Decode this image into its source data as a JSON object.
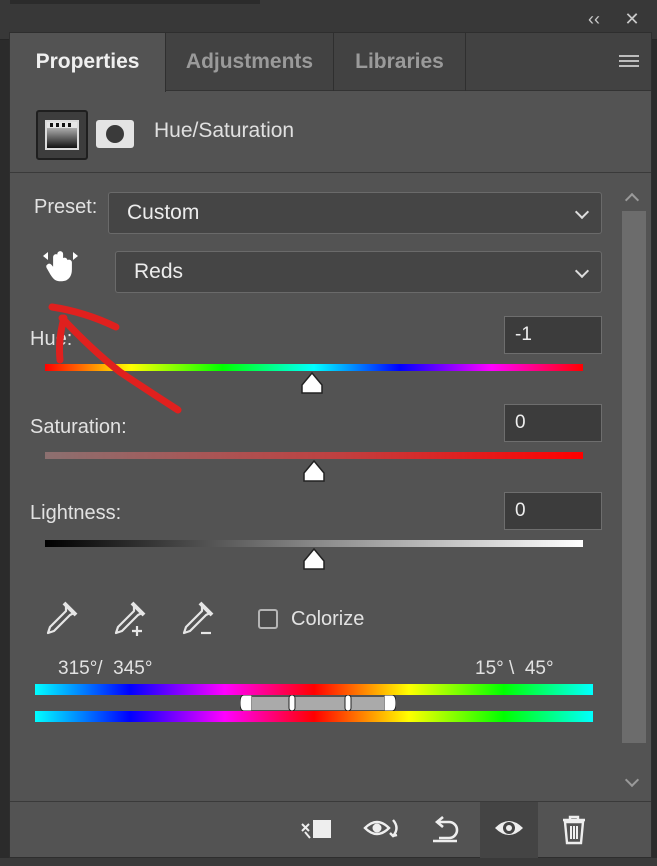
{
  "window": {
    "collapse_glyph": "‹‹",
    "close_glyph": "✕"
  },
  "tabs": [
    {
      "label": "Properties",
      "active": true
    },
    {
      "label": "Adjustments",
      "active": false
    },
    {
      "label": "Libraries",
      "active": false
    }
  ],
  "header": {
    "adjustment_title": "Hue/Saturation",
    "icons": [
      "adjustment-layer-icon",
      "layer-mask-icon"
    ]
  },
  "preset": {
    "label": "Preset:",
    "value": "Custom"
  },
  "channel": {
    "value": "Reds",
    "targeted_adjustment_icon": "hand-scrubber-icon"
  },
  "sliders": {
    "hue": {
      "label": "Hue:",
      "value": "-1",
      "position_fraction": 0.497
    },
    "saturation": {
      "label": "Saturation:",
      "value": "0",
      "position_fraction": 0.5
    },
    "lightness": {
      "label": "Lightness:",
      "value": "0",
      "position_fraction": 0.5
    }
  },
  "tools": {
    "eyedroppers": [
      "eyedropper-icon",
      "eyedropper-add-icon",
      "eyedropper-subtract-icon"
    ],
    "colorize_label": "Colorize",
    "colorize_checked": false
  },
  "range": {
    "left_text": "315°/  345°",
    "right_text": "15° \\  45°"
  },
  "footer_icons": [
    "clip-to-layer-icon",
    "view-previous-state-icon",
    "reset-icon",
    "visibility-eye-icon",
    "delete-icon"
  ],
  "colors": {
    "panel_bg": "#535353",
    "tab_bar_bg": "#424242",
    "annotation_red": "#e0201e"
  }
}
